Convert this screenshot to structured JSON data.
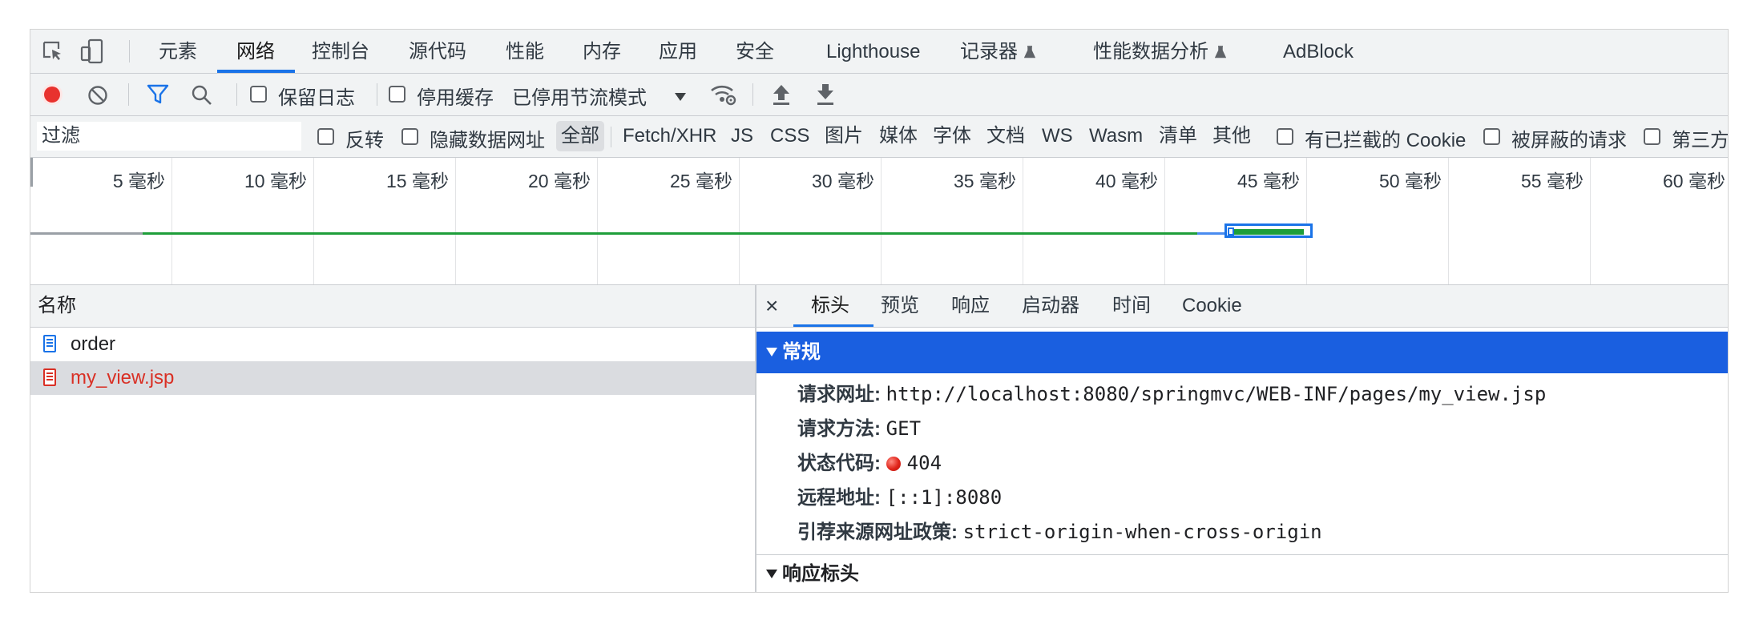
{
  "main_tabs": [
    {
      "label": "元素"
    },
    {
      "label": "网络"
    },
    {
      "label": "控制台"
    },
    {
      "label": "源代码"
    },
    {
      "label": "性能"
    },
    {
      "label": "内存"
    },
    {
      "label": "应用"
    },
    {
      "label": "安全"
    },
    {
      "label": "Lighthouse"
    },
    {
      "label": "记录器"
    },
    {
      "label": "性能数据分析"
    },
    {
      "label": "AdBlock"
    }
  ],
  "active_tab": "网络",
  "toolbar": {
    "preserve_log": "保留日志",
    "disable_cache": "停用缓存",
    "throttling": "已停用节流模式"
  },
  "filter": {
    "placeholder": "过滤",
    "invert": "反转",
    "hide_data_urls": "隐藏数据网址",
    "types": [
      "全部",
      "Fetch/XHR",
      "JS",
      "CSS",
      "图片",
      "媒体",
      "字体",
      "文档",
      "WS",
      "Wasm",
      "清单",
      "其他"
    ],
    "blocked_cookies": "有已拦截的 Cookie",
    "blocked_requests": "被屏蔽的请求",
    "third_party": "第三方"
  },
  "timeline": {
    "ticks": [
      "5 毫秒",
      "10 毫秒",
      "15 毫秒",
      "20 毫秒",
      "25 毫秒",
      "30 毫秒",
      "35 毫秒",
      "40 毫秒",
      "45 毫秒",
      "50 毫秒",
      "55 毫秒",
      "60 毫秒"
    ]
  },
  "requests": {
    "name_header": "名称",
    "rows": [
      {
        "name": "order",
        "status": "ok"
      },
      {
        "name": "my_view.jsp",
        "status": "error"
      }
    ]
  },
  "details": {
    "close": "×",
    "tabs": [
      "标头",
      "预览",
      "响应",
      "启动器",
      "时间",
      "Cookie"
    ],
    "active_tab": "标头",
    "general_title": "常规",
    "general": [
      {
        "key": "请求网址:",
        "value": "http://localhost:8080/springmvc/WEB-INF/pages/my_view.jsp"
      },
      {
        "key": "请求方法:",
        "value": "GET"
      },
      {
        "key": "状态代码:",
        "value": "404"
      },
      {
        "key": "远程地址:",
        "value": "[::1]:8080"
      },
      {
        "key": "引荐来源网址政策:",
        "value": "strict-origin-when-cross-origin"
      }
    ],
    "response_headers_title": "响应标头"
  },
  "colors": {
    "accent": "#1a73e8",
    "record": "#e8322e",
    "section_header": "#1a5fe0",
    "error_text": "#d93025",
    "timeline_green": "#1e9e3a"
  }
}
